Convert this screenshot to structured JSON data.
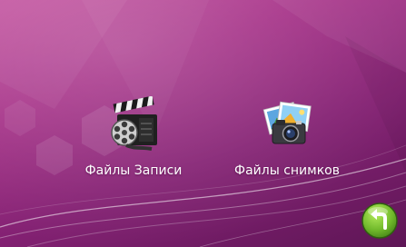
{
  "screen": {
    "menu_items": [
      {
        "label": "Файлы Записи",
        "icon": "video-clapperboard-icon"
      },
      {
        "label": "Файлы снимков",
        "icon": "photo-camera-icon"
      }
    ],
    "back_button": {
      "icon": "back-arrow-icon"
    }
  },
  "colors": {
    "background_top": "#c04b9b",
    "background_bottom": "#5e1656",
    "label_text": "#ffffff",
    "back_button": "#6fb82a"
  }
}
